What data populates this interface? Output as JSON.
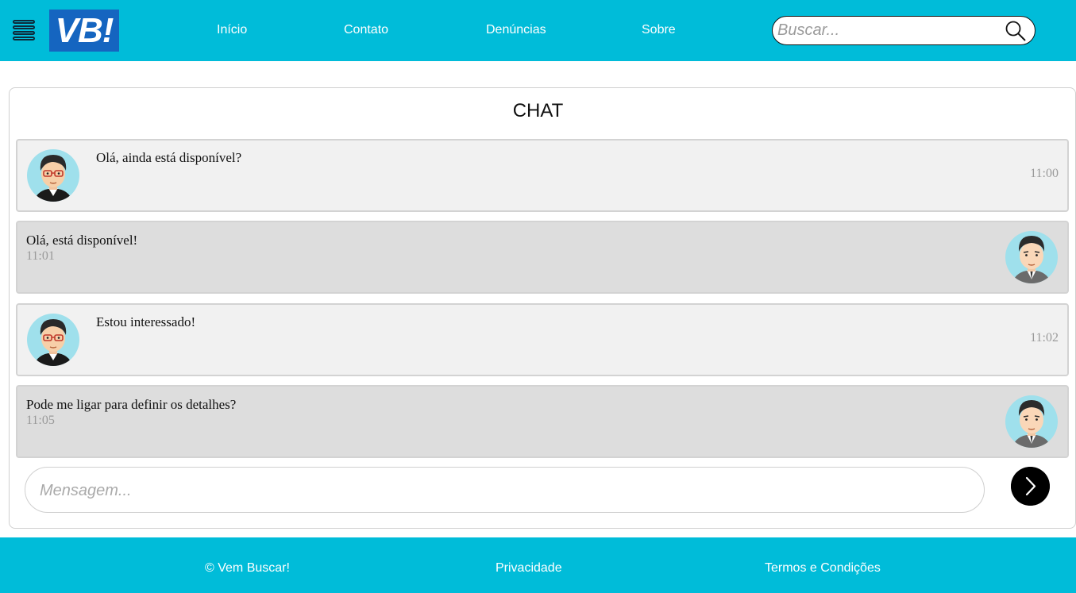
{
  "header": {
    "logo_text": "VB!",
    "nav": [
      {
        "label": "Início"
      },
      {
        "label": "Contato"
      },
      {
        "label": "Denúncias"
      },
      {
        "label": "Sobre"
      }
    ],
    "search": {
      "placeholder": "Buscar..."
    }
  },
  "chat": {
    "title": "CHAT",
    "messages": [
      {
        "direction": "in",
        "text": "Olá, ainda está disponível?",
        "time": "11:00"
      },
      {
        "direction": "out",
        "text": "Olá, está disponível!",
        "time": "11:01"
      },
      {
        "direction": "in",
        "text": "Estou interessado!",
        "time": "11:02"
      },
      {
        "direction": "out",
        "text": "Pode me ligar para definir os detalhes?",
        "time": "11:05"
      }
    ],
    "composer": {
      "placeholder": "Mensagem..."
    }
  },
  "footer": {
    "copyright": "© Vem Buscar!",
    "privacy": "Privacidade",
    "terms": "Termos e Condições"
  },
  "colors": {
    "brand_bar": "#00bcd9",
    "logo_bg": "#1565c0",
    "incoming_bg": "#f1f1f1",
    "outgoing_bg": "#dddddd",
    "avatar_bg": "#9fe0ec"
  }
}
